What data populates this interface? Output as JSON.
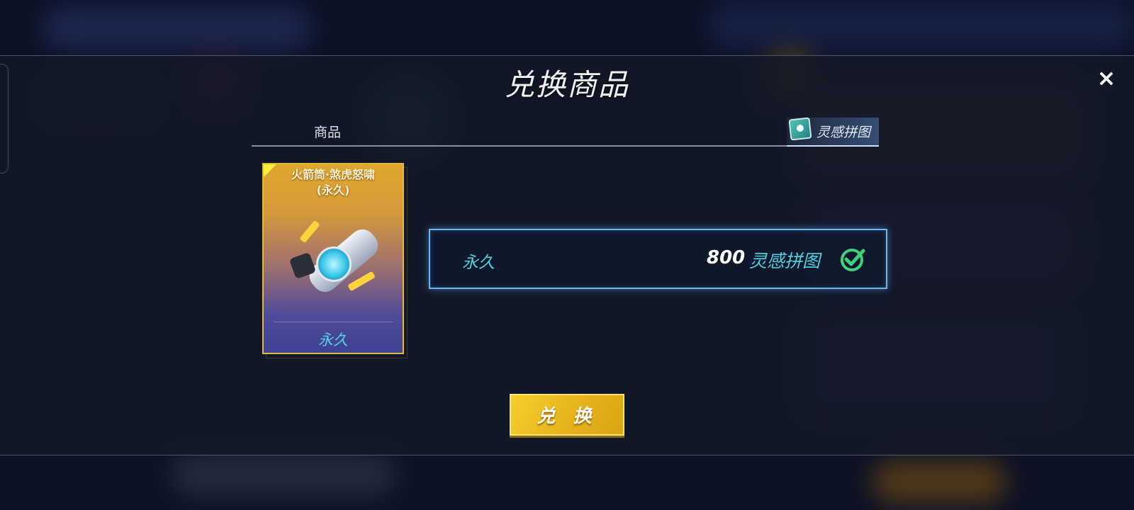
{
  "dialog": {
    "title": "兑换商品",
    "close_label": "×"
  },
  "header": {
    "item_column_label": "商品",
    "currency_label": "灵感拼图",
    "currency_icon": "puzzle-icon"
  },
  "item_card": {
    "title_line1": "火箭筒·煞虎怒啸",
    "title_line2": "(永久)",
    "duration_label": "永久",
    "image_icon": "rocket-launcher-icon"
  },
  "price_option": {
    "duration": "永久",
    "price": "800",
    "currency": "灵感拼图",
    "selected": true,
    "status_icon": "check-circle-icon"
  },
  "exchange_button": {
    "label": "兑 换"
  },
  "colors": {
    "accent_teal": "#4fd0dc",
    "button_gold": "#e6b31c",
    "selection_border": "#66b8f2",
    "check_green": "#3fd07a"
  }
}
